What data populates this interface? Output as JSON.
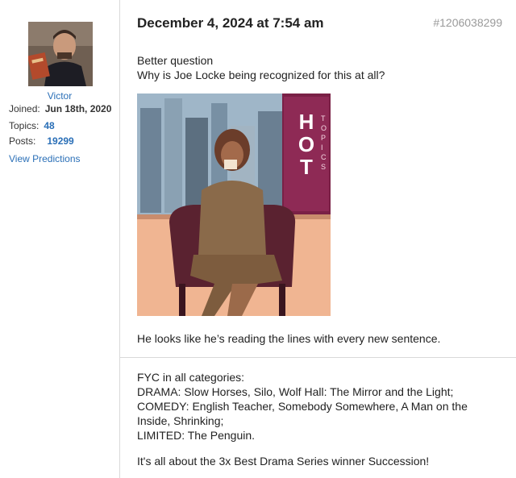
{
  "sidebar": {
    "username": "Victor",
    "joined_label": "Joined:",
    "joined_value": "Jun 18th, 2020",
    "topics_label": "Topics:",
    "topics_value": "48",
    "posts_label": "Posts:",
    "posts_value": "19299",
    "view_predictions": "View Predictions"
  },
  "post": {
    "date": "December 4, 2024 at 7:54 am",
    "id": "#1206038299",
    "line1": "Better question",
    "line2": "Why is Joe Locke being recognized for this at all?",
    "gif_sign_letters": "HOT",
    "gif_sign_small": "TOPICS",
    "caption": "He looks like he’s reading the lines with every new sentence."
  },
  "signature": {
    "line1": "FYC in all categories:",
    "line2": "DRAMA: Slow Horses, Silo, Wolf Hall: The Mirror and the Light;",
    "line3": "COMEDY: English Teacher, Somebody Somewhere, A Man on the Inside, Shrinking;",
    "line4": "LIMITED: The Penguin.",
    "line5": "It's all about the 3x Best Drama Series winner Succession!"
  }
}
